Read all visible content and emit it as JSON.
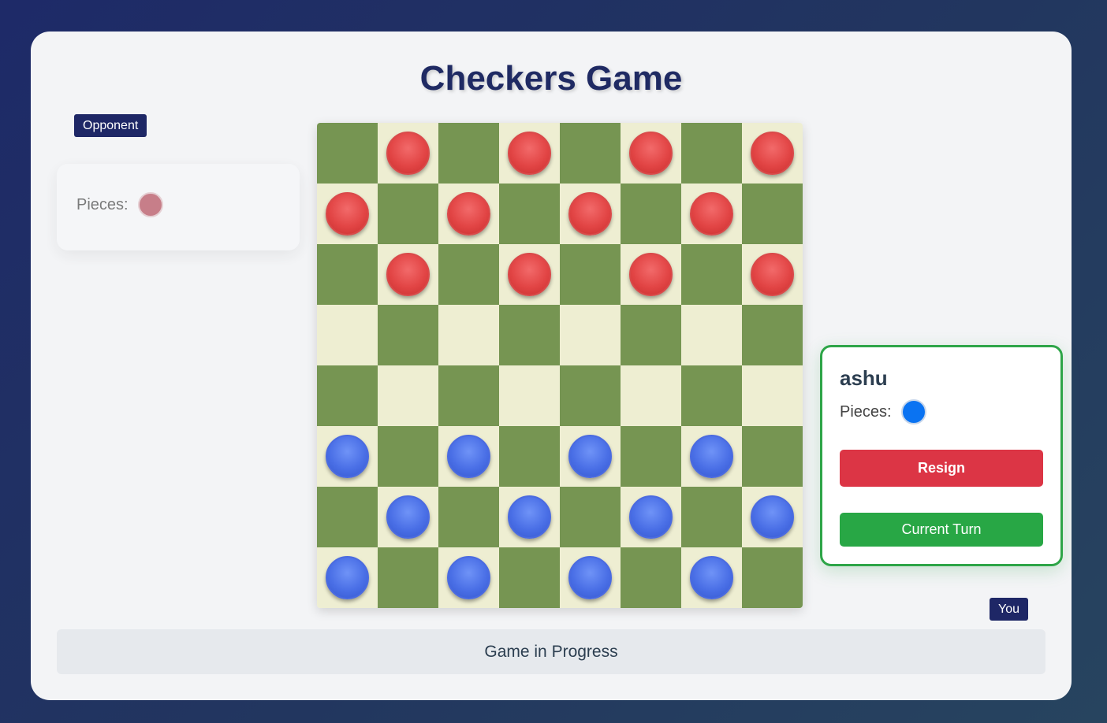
{
  "title": "Checkers Game",
  "opponent": {
    "tag": "Opponent",
    "pieces_label": "Pieces:",
    "piece_color": "#c06a76"
  },
  "player": {
    "tag": "You",
    "name": "ashu",
    "pieces_label": "Pieces:",
    "piece_color": "#0a73f2",
    "resign_label": "Resign",
    "turn_label": "Current Turn"
  },
  "status": "Game in Progress",
  "colors": {
    "light_square": "#eeeed2",
    "dark_square": "#769552",
    "red_piece": "#e24545",
    "blue_piece": "#4a6fe6",
    "resign": "#dc3545",
    "turn": "#28a745"
  },
  "board": [
    ". r . r . r . r",
    "r . r . r . r .",
    ". r . r . r . r",
    ". . . . . . . .",
    ". . . . . . . .",
    "b . b . b . b .",
    ". b . b . b . b",
    "b . b . b . b ."
  ]
}
